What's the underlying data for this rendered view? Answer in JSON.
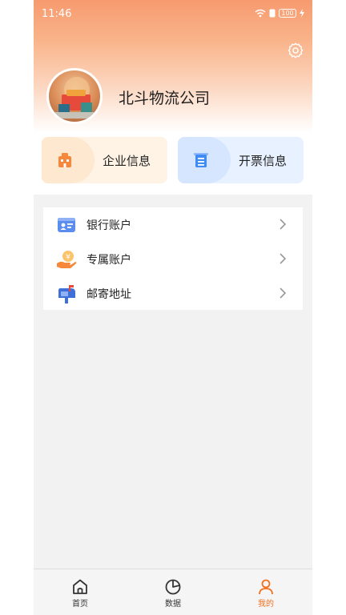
{
  "status_bar": {
    "time": "11:46",
    "battery": "100"
  },
  "header": {
    "company_name": "北斗物流公司",
    "settings_icon": "gear-icon",
    "avatar": "company-avatar"
  },
  "quick_cards": [
    {
      "label": "企业信息",
      "icon": "building-icon",
      "color": "#f7873a"
    },
    {
      "label": "开票信息",
      "icon": "invoice-icon",
      "color": "#3f8cf7"
    }
  ],
  "menu": {
    "items": [
      {
        "label": "银行账户",
        "icon": "bank-card-icon"
      },
      {
        "label": "专属账户",
        "icon": "coin-hand-icon"
      },
      {
        "label": "邮寄地址",
        "icon": "mailbox-icon"
      }
    ]
  },
  "tab_bar": {
    "tabs": [
      {
        "label": "首页",
        "icon": "home-icon",
        "active": false
      },
      {
        "label": "数据",
        "icon": "pie-chart-icon",
        "active": false
      },
      {
        "label": "我的",
        "icon": "user-icon",
        "active": true
      }
    ],
    "active_color": "#f2701f"
  }
}
